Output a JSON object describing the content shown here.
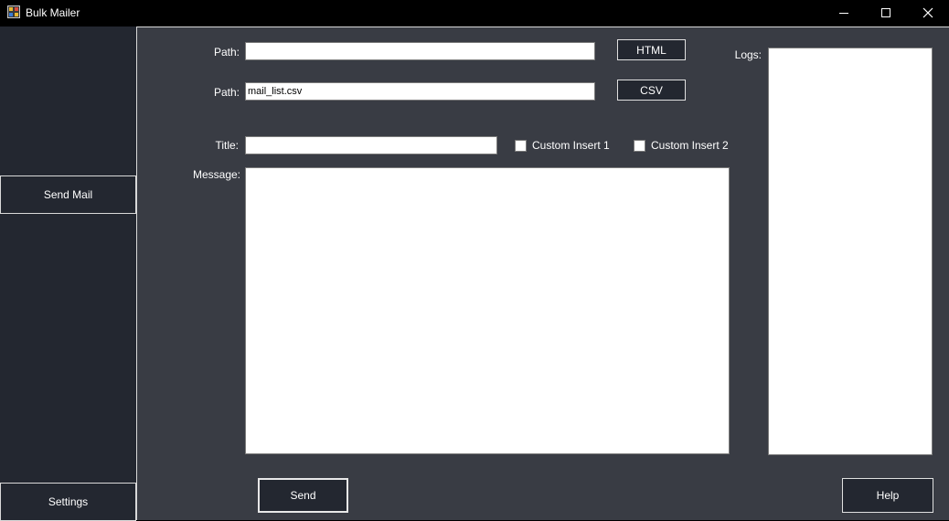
{
  "window": {
    "title": "Bulk Mailer"
  },
  "sidebar": {
    "send_mail_label": "Send Mail",
    "settings_label": "Settings"
  },
  "form": {
    "html_path_label": "Path:",
    "html_path_value": "",
    "html_button_label": "HTML",
    "csv_path_label": "Path:",
    "csv_path_value": "mail_list.csv",
    "csv_button_label": "CSV",
    "title_label": "Title:",
    "title_value": "",
    "custom_insert_1_label": "Custom Insert 1",
    "custom_insert_1_checked": false,
    "custom_insert_2_label": "Custom Insert 2",
    "custom_insert_2_checked": false,
    "message_label": "Message:",
    "message_value": "",
    "send_button_label": "Send"
  },
  "logs": {
    "label": "Logs:",
    "content": ""
  },
  "help_button_label": "Help",
  "icons": {
    "app": "app-icon",
    "minimize": "minimize-icon",
    "maximize": "maximize-icon",
    "close": "close-icon"
  },
  "colors": {
    "titlebar": "#000000",
    "sidebar": "#232730",
    "main_panel": "#393c44",
    "text": "#ffffff"
  }
}
